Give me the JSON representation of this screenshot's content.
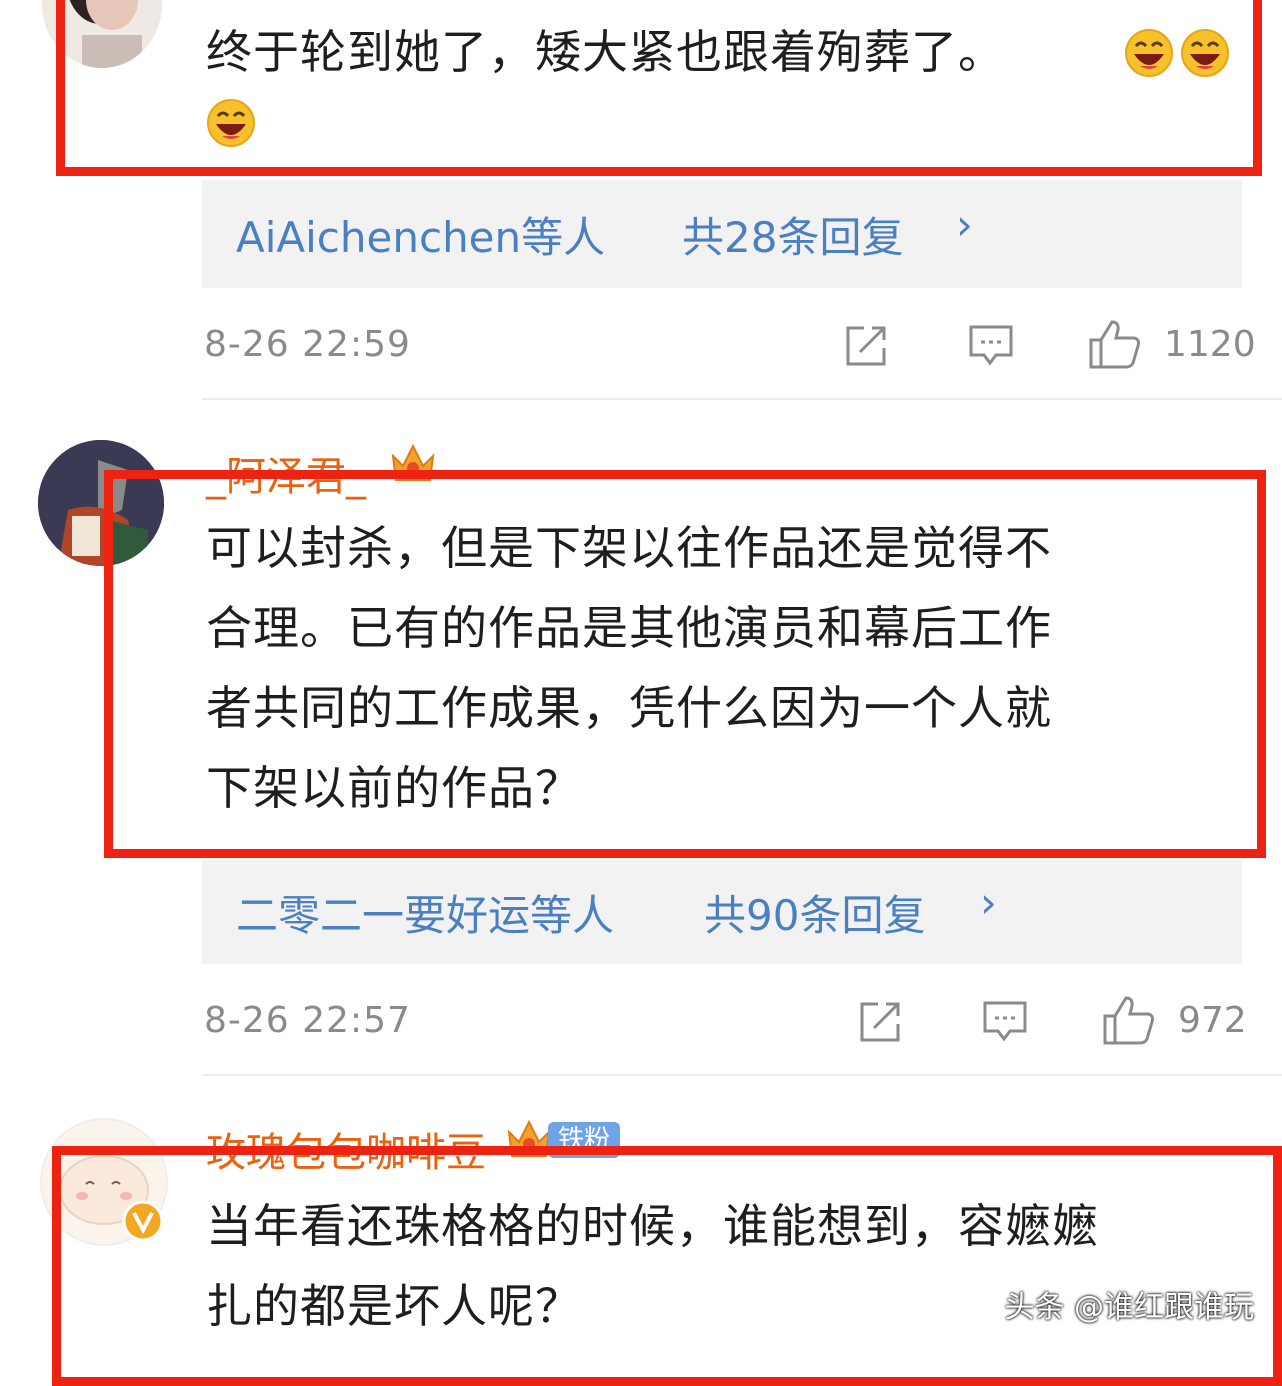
{
  "comments": [
    {
      "text_line1": "终于轮到她了，矮大紧也跟着殉葬了。",
      "emojis": [
        "laughing-emoji",
        "laughing-emoji",
        "laughing-emoji"
      ],
      "reply_names": "AiAichenchen等人",
      "reply_count": "共28条回复",
      "time": "8-26 22:59",
      "likes": "1120"
    },
    {
      "username": "_阿泽君_",
      "lines": [
        "可以封杀，但是下架以往作品还是觉得不",
        "合理。已有的作品是其他演员和幕后工作",
        "者共同的工作成果，凭什么因为一个人就",
        "下架以前的作品？"
      ],
      "reply_names": "二零二一要好运等人",
      "reply_count": "共90条回复",
      "time": "8-26 22:57",
      "likes": "972"
    },
    {
      "username": "玫瑰包包咖啡豆",
      "badge": "铁粉",
      "lines": [
        "当年看还珠格格的时候，谁能想到，容嬷嬷",
        "扎的都是坏人呢？"
      ]
    }
  ],
  "reply_chevron": "›",
  "watermark": "头条 @谁红跟谁玩",
  "colors": {
    "highlight": "#ee2211",
    "link": "#4a7fc1",
    "username": "#e8620f",
    "reply_bg": "#f2f2f2"
  }
}
